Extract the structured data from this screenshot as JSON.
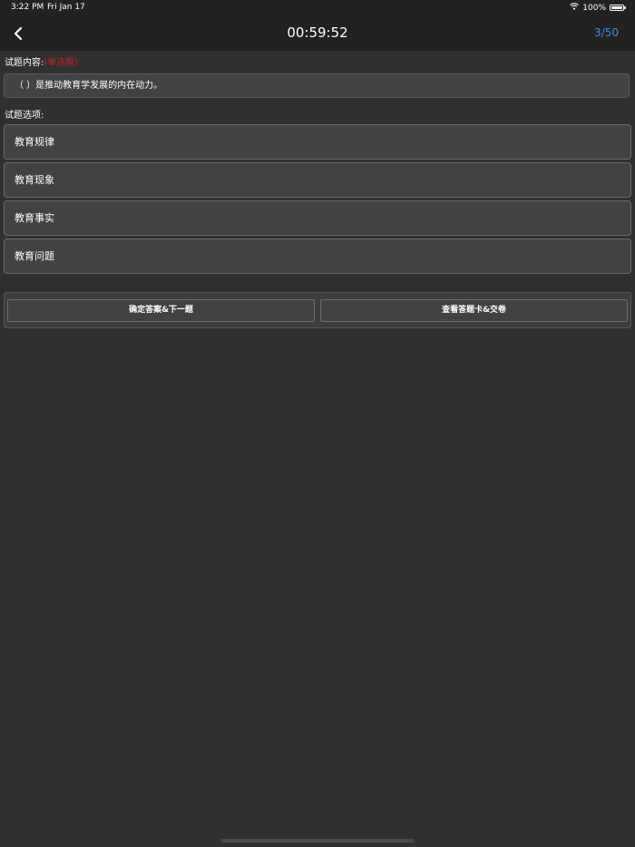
{
  "status_bar": {
    "time": "3:22 PM",
    "date": "Fri Jan 17",
    "battery": "100%",
    "icons": [
      "wifi-icon",
      "battery-icon"
    ]
  },
  "nav": {
    "back_icon": "chevron-left-icon",
    "timer": "00:59:52",
    "progress": "3/50"
  },
  "question": {
    "label": "试题内容:",
    "type": "(单选题)",
    "text": "（    ）是推动教育学发展的内在动力。"
  },
  "options_label": "试题选项:",
  "options": [
    {
      "label": "教育规律"
    },
    {
      "label": "教育现象"
    },
    {
      "label": "教育事实"
    },
    {
      "label": "教育问题"
    }
  ],
  "actions": {
    "confirm_label": "确定答案&下一题",
    "answer_card_label": "查看答题卡&交卷"
  },
  "colors": {
    "background": "#303030",
    "bar": "#222222",
    "accent": "#3b8de6",
    "type_tag": "#d11f1f"
  }
}
